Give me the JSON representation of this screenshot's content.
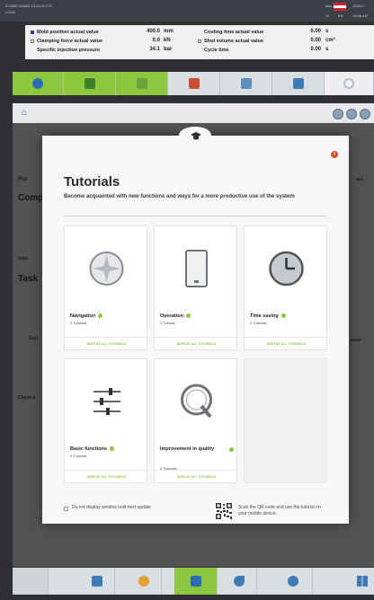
{
  "statusbar": {
    "line1": "312580 CM820 13:11:04:175",
    "line2": "c1300",
    "user": "tufa",
    "time": "12/9/17",
    "sub": "11",
    "sub2": "EN",
    "sub3": "10:38 AM"
  },
  "process_values": {
    "left": [
      {
        "label": "Mold position actual value",
        "value": "400.0",
        "unit": "mm"
      },
      {
        "label": "Clamping force actual value",
        "value": "0.0",
        "unit": "kN"
      },
      {
        "label": "Specific injection pressure",
        "value": "34.1",
        "unit": "bar"
      }
    ],
    "right": [
      {
        "label": "Cooling time actual value",
        "value": "0.00",
        "unit": "s"
      },
      {
        "label": "Shot volume actual value",
        "value": "0.00",
        "unit": "cm³"
      },
      {
        "label": "Cycle time",
        "value": "0.00",
        "unit": "s"
      }
    ]
  },
  "colors": {
    "accent_green": "#8dc63f",
    "close_orange": "#e5502c",
    "nav_bg": "#d9dee3"
  },
  "background_labels": {
    "comp": "Comp",
    "task": "Task",
    "pro": "Pro",
    "injec": "Injec",
    "con": "Con",
    "check": "Check p",
    "um": "um",
    "ance": "ance"
  },
  "modal": {
    "title": "Tutorials",
    "subtitle": "Become acquainted with new functions and ways for a more productive use of the system",
    "cards": [
      {
        "name": "Navigation",
        "count": "2 Tutorials",
        "link": "DISPLAY ALL TUTORIALS",
        "icon": "compass-icon"
      },
      {
        "name": "Operation",
        "count": "1 Tutorial",
        "link": "DISPLAY ALL TUTORIALS",
        "icon": "tablet-icon"
      },
      {
        "name": "Time saving",
        "count": "2 Tutorials",
        "link": "DISPLAY ALL TUTORIALS",
        "icon": "clock-icon"
      },
      {
        "name": "Basic functions",
        "count": "2 Tutorials",
        "link": "DISPLAY ALL TUTORIALS",
        "icon": "sliders-icon"
      },
      {
        "name": "Improvement in quality",
        "count": "4 Tutorials",
        "link": "DISPLAY ALL TUTORIALS",
        "icon": "q-icon"
      }
    ],
    "checkbox_label": "Do not display window until next update",
    "qr_text": "Scan the QR code and use the tutorial on your mobile device."
  }
}
